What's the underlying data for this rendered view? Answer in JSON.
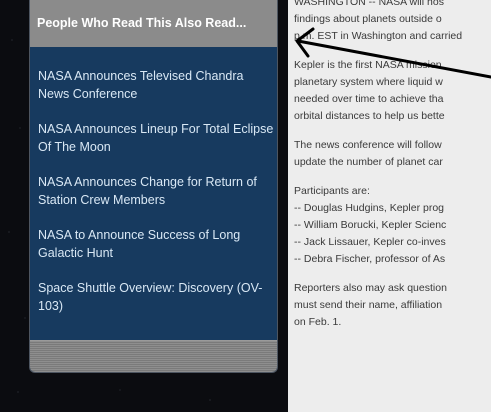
{
  "sidebar": {
    "header": "People Who Read This Also Read...",
    "links": [
      "NASA Announces Televised Chandra News Conference",
      "NASA Announces Lineup For Total Eclipse Of The Moon",
      "NASA Announces Change for Return of Station Crew Members",
      "NASA to Announce Success of Long Galactic Hunt",
      "Space Shuttle Overview: Discovery (OV-103)"
    ]
  },
  "article": {
    "lines": [
      "WASHINGTON -- NASA will hos",
      "findings about planets outside o",
      "p.m. EST in Washington and carried",
      "",
      "Kepler is the first NASA mission",
      "planetary system where liquid w",
      "needed over time to achieve tha",
      "orbital distances to help us bette",
      "",
      "The news conference will follow",
      "update the number of planet car",
      "",
      "Participants are:",
      "-- Douglas Hudgins, Kepler prog",
      "-- William Borucki, Kepler Scienc",
      "-- Jack Lissauer, Kepler co-inves",
      "-- Debra Fischer, professor of As",
      "",
      "Reporters also may ask question",
      "must send their name, affiliation",
      "on Feb. 1."
    ]
  },
  "colors": {
    "panel_bg": "#173a5f",
    "panel_header_bg": "#8b8b8b",
    "link_text": "#d9e8f5",
    "article_bg": "#ededed",
    "arrow": "#000000"
  },
  "icons": {
    "annotation": "arrow-icon"
  }
}
